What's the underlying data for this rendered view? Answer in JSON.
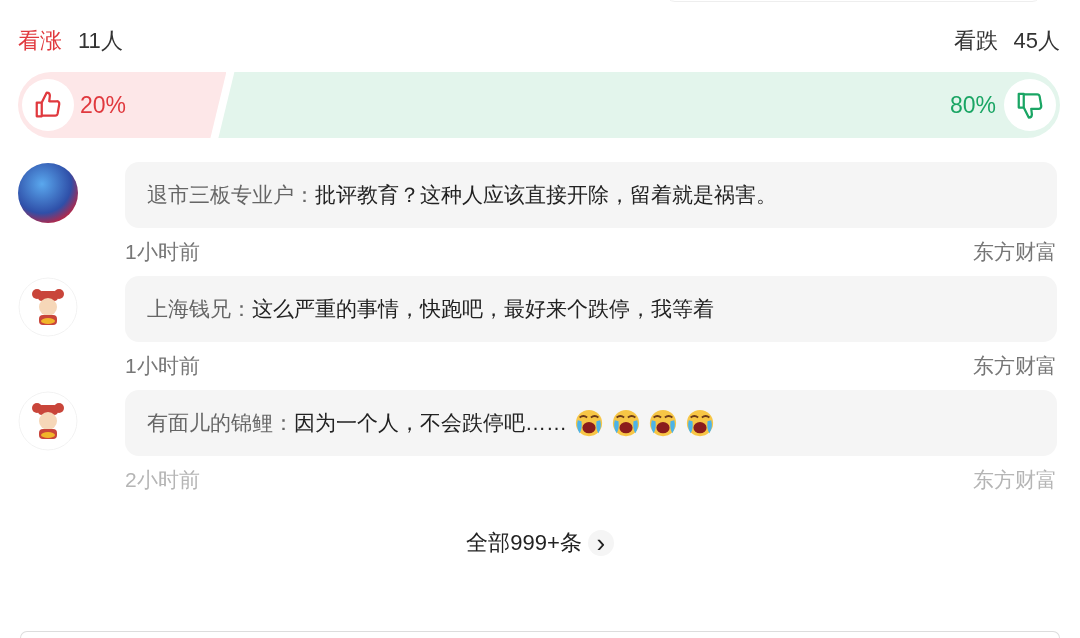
{
  "vote": {
    "bull_label": "看涨",
    "bull_count": "11人",
    "bear_label": "看跌",
    "bear_count": "45人",
    "bull_percent": "20%",
    "bear_percent": "80%",
    "level": 0.2
  },
  "comments": [
    {
      "kind": "photo",
      "author": "退市三板专业户：",
      "text": "批评教育？这种人应该直接开除，留着就是祸害。",
      "time": "1小时前",
      "source": "东方财富",
      "dimmed": false
    },
    {
      "kind": "cartoon",
      "author": "上海钱兄：",
      "text": "这么严重的事情，快跑吧，最好来个跌停，我等着",
      "time": "1小时前",
      "source": "东方财富",
      "dimmed": false
    },
    {
      "kind": "cartoon",
      "author": "有面儿的锦鲤：",
      "text": "因为一个人，不会跌停吧……",
      "emojis": [
        {
          "kind": "crying"
        },
        {
          "kind": "crying"
        },
        {
          "kind": "crying"
        },
        {
          "kind": "crying"
        }
      ],
      "time": "2小时前",
      "source": "东方财富",
      "dimmed": true
    }
  ],
  "more": {
    "label": "全部999+条",
    "chevron": "›"
  }
}
